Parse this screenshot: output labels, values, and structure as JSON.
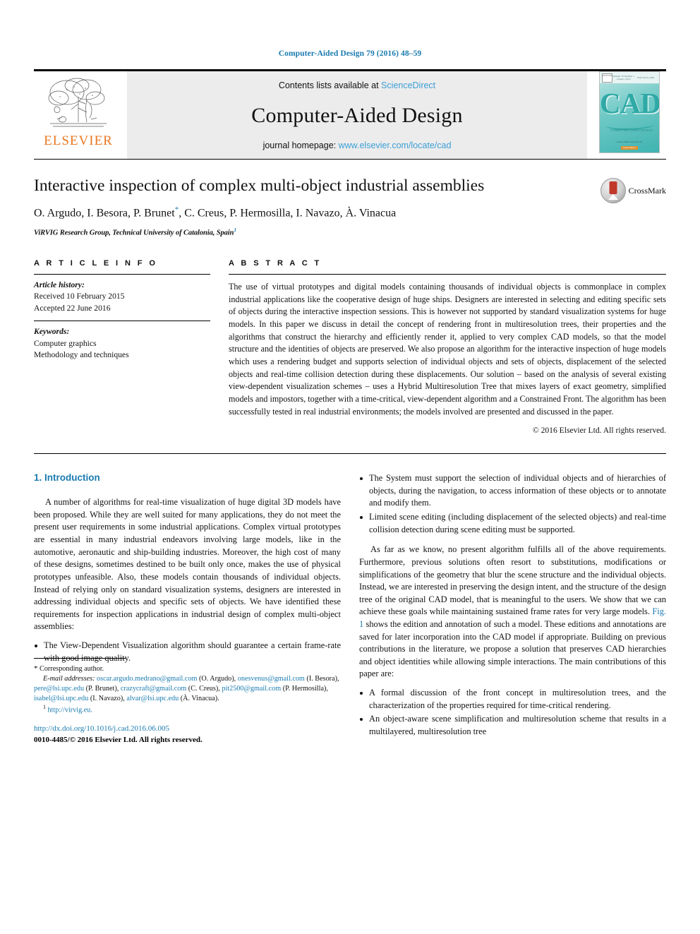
{
  "running_head": "Computer-Aided Design 79 (2016) 48–59",
  "masthead": {
    "publisher_logo_text": "ELSEVIER",
    "contents_prefix": "Contents lists available at",
    "contents_link": "ScienceDirect",
    "journal_name": "Computer-Aided Design",
    "homepage_prefix": "journal homepage:",
    "homepage_link": "www.elsevier.com/locate/cad",
    "cover": {
      "title": "CAD",
      "subtitle": "COMPUTER-AIDED DESIGN",
      "top_left_mark": "ELSEVIER",
      "top_text": "Volume 79  Number 1  January 2016",
      "top_right": "ISSN 0010-4485",
      "bottom_text": "AVAILABLE ONLINE AT",
      "bottom_brand": "ScienceDirect"
    }
  },
  "article": {
    "title": "Interactive inspection of complex multi-object industrial assemblies",
    "authors": "O. Argudo, I. Besora, P. Brunet",
    "authors_rest": ", C. Creus, P. Hermosilla, I. Navazo, À. Vinacua",
    "corresponding_marker": "*",
    "affiliation": "ViRVIG Research Group, Technical University of Catalonia, Spain",
    "affiliation_sup": "1",
    "crossmark_label": "CrossMark"
  },
  "article_info": {
    "heading": "A R T I C L E    I N F O",
    "history_label": "Article history:",
    "history": [
      "Received 10 February 2015",
      "Accepted 22 June 2016"
    ],
    "keywords_label": "Keywords:",
    "keywords": [
      "Computer graphics",
      "Methodology and techniques"
    ]
  },
  "abstract": {
    "heading": "A B S T R A C T",
    "text": "The use of virtual prototypes and digital models containing thousands of individual objects is commonplace in complex industrial applications like the cooperative design of huge ships. Designers are interested in selecting and editing specific sets of objects during the interactive inspection sessions. This is however not supported by standard visualization systems for huge models. In this paper we discuss in detail the concept of rendering front in multiresolution trees, their properties and the algorithms that construct the hierarchy and efficiently render it, applied to very complex CAD models, so that the model structure and the identities of objects are preserved. We also propose an algorithm for the interactive inspection of huge models which uses a rendering budget and supports selection of individual objects and sets of objects, displacement of the selected objects and real-time collision detection during these displacements. Our solution – based on the analysis of several existing view-dependent visualization schemes – uses a Hybrid Multiresolution Tree that mixes layers of exact geometry, simplified models and impostors, together with a time-critical, view-dependent algorithm and a Constrained Front. The algorithm has been successfully tested in real industrial environments; the models involved are presented and discussed in the paper.",
    "copyright": "© 2016 Elsevier Ltd. All rights reserved."
  },
  "body": {
    "section_number": "1.",
    "section_title": "Introduction",
    "left_para_1": "A number of algorithms for real-time visualization of huge digital 3D models have been proposed. While they are well suited for many applications, they do not meet the present user requirements in some industrial applications. Complex virtual prototypes are essential in many industrial endeavors involving large models, like in the automotive, aeronautic and ship-building industries. Moreover, the high cost of many of these designs, sometimes destined to be built only once, makes the use of physical prototypes unfeasible. Also, these models contain thousands of individual objects. Instead of relying only on standard visualization systems, designers are interested in addressing individual objects and specific sets of objects. We have identified these requirements for inspection applications in industrial design of complex multi-object assemblies:",
    "left_bullets": [
      "The View-Dependent Visualization algorithm should guarantee a certain frame-rate with good image quality."
    ],
    "right_bullets_top": [
      "The System must support the selection of individual objects and of hierarchies of objects, during the navigation, to access information of these objects or to annotate and modify them.",
      "Limited scene editing (including displacement of the selected objects) and real-time collision detection during scene editing must be supported."
    ],
    "right_para_1a": "As far as we know, no present algorithm fulfills all of the above requirements. Furthermore, previous solutions often resort to substitutions, modifications or simplifications of the geometry that blur the scene structure and the individual objects. Instead, we are interested in preserving the design intent, and the structure of the design tree of the original CAD model, that is meaningful to the users. We show that we can achieve these goals while maintaining sustained frame rates for very large models. ",
    "right_fig_ref": "Fig. 1",
    "right_para_1b": " shows the edition and annotation of such a model. These editions and annotations are saved for later incorporation into the CAD model if appropriate. Building on previous contributions in the literature, we propose a solution that preserves CAD hierarchies and object identities while allowing simple interactions. The main contributions of this paper are:",
    "right_bullets_bottom": [
      "A formal discussion of the front concept in multiresolution trees, and the characterization of the properties required for time-critical rendering.",
      "An object-aware scene simplification and multiresolution scheme that results in a multilayered, multiresolution tree"
    ]
  },
  "footnotes": {
    "corresponding_marker": "*",
    "corresponding_text": "Corresponding author.",
    "email_label": "E-mail addresses:",
    "emails": [
      {
        "address": "oscar.argudo.medrano@gmail.com",
        "name": "(O. Argudo),"
      },
      {
        "address": "onesvenus@gmail.com",
        "name": "(I. Besora),"
      },
      {
        "address": "pere@lsi.upc.edu",
        "name": "(P. Brunet),"
      },
      {
        "address": "crazycraft@gmail.com",
        "name": "(C. Creus),"
      },
      {
        "address": "pit2500@gmail.com",
        "name": "(P. Hermosilla),"
      },
      {
        "address": "isabel@lsi.upc.edu",
        "name": "(I. Navazo),"
      },
      {
        "address": "alvar@lsi.upc.edu",
        "name": "(À. Vinacua)."
      }
    ],
    "footnote_1_marker": "1",
    "footnote_1_text": "http://virvig.eu.",
    "doi": "http://dx.doi.org/10.1016/j.cad.2016.06.005",
    "issn_line": "0010-4485/© 2016 Elsevier Ltd. All rights reserved."
  }
}
